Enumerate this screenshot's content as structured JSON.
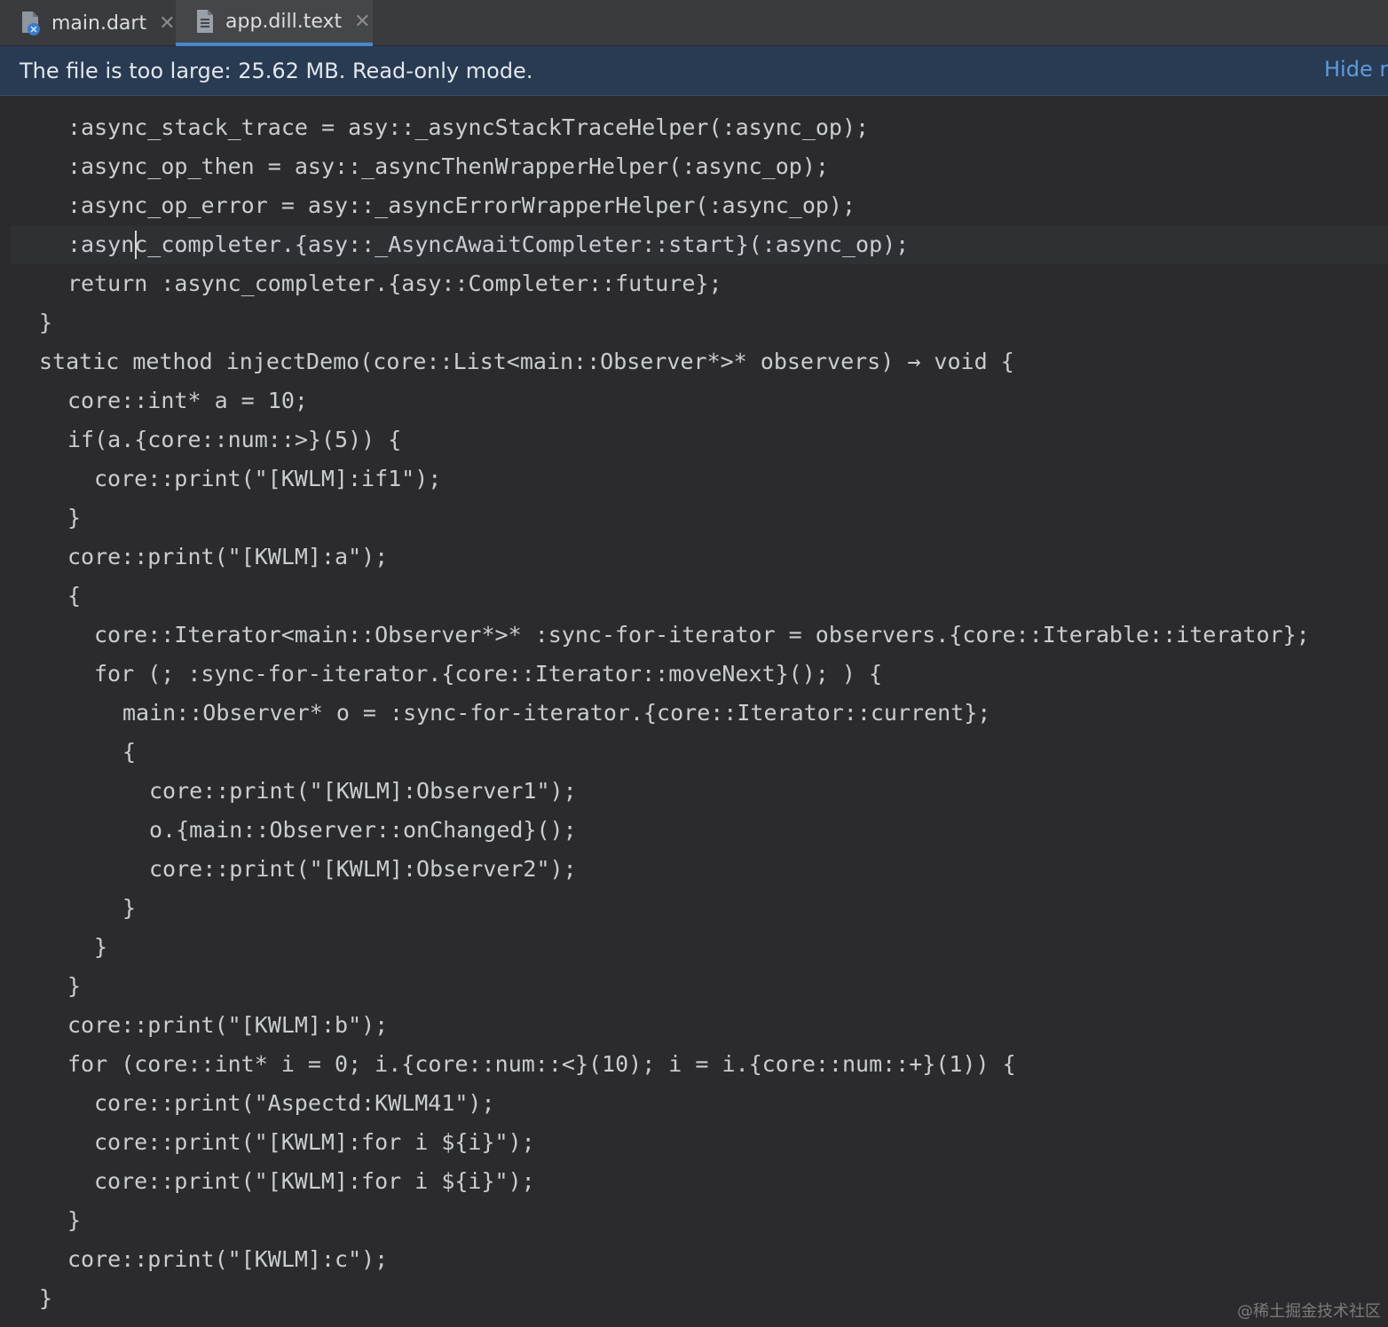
{
  "tabs": [
    {
      "label": "main.dart",
      "icon": "dart-file-icon",
      "active": false
    },
    {
      "label": "app.dill.text",
      "icon": "text-file-icon",
      "active": true
    }
  ],
  "banner": {
    "message": "The file is too large: 25.62 MB. Read-only mode.",
    "action": "Hide r"
  },
  "editor": {
    "lines": [
      ":async_stack_trace = asy::_asyncStackTraceHelper(:async_op);",
      ":async_op_then = asy::_asyncThenWrapperHelper(:async_op);",
      ":async_op_error = asy::_asyncErrorWrapperHelper(:async_op);",
      ":async_completer.{asy::_AsyncAwaitCompleter::start}(:async_op);",
      "return :async_completer.{asy::Completer::future};",
      "}",
      "static method injectDemo(core::List<main::Observer*>* observers) → void {",
      "core::int* a = 10;",
      "if(a.{core::num::>}(5)) {",
      "core::print(\"[KWLM]:if1\");",
      "}",
      "core::print(\"[KWLM]:a\");",
      "{",
      "core::Iterator<main::Observer*>* :sync-for-iterator = observers.{core::Iterable::iterator};",
      "for (; :sync-for-iterator.{core::Iterator::moveNext}(); ) {",
      "main::Observer* o = :sync-for-iterator.{core::Iterator::current};",
      "{",
      "core::print(\"[KWLM]:Observer1\");",
      "o.{main::Observer::onChanged}();",
      "core::print(\"[KWLM]:Observer2\");",
      "}",
      "}",
      "}",
      "core::print(\"[KWLM]:b\");",
      "for (core::int* i = 0; i.{core::num::<}(10); i = i.{core::num::+}(1)) {",
      "core::print(\"Aspectd:KWLM41\");",
      "core::print(\"[KWLM]:for i ${i}\");",
      "core::print(\"[KWLM]:for i ${i}\");",
      "}",
      "core::print(\"[KWLM]:c\");",
      "}"
    ]
  },
  "watermark": "@稀土掘金技术社区"
}
